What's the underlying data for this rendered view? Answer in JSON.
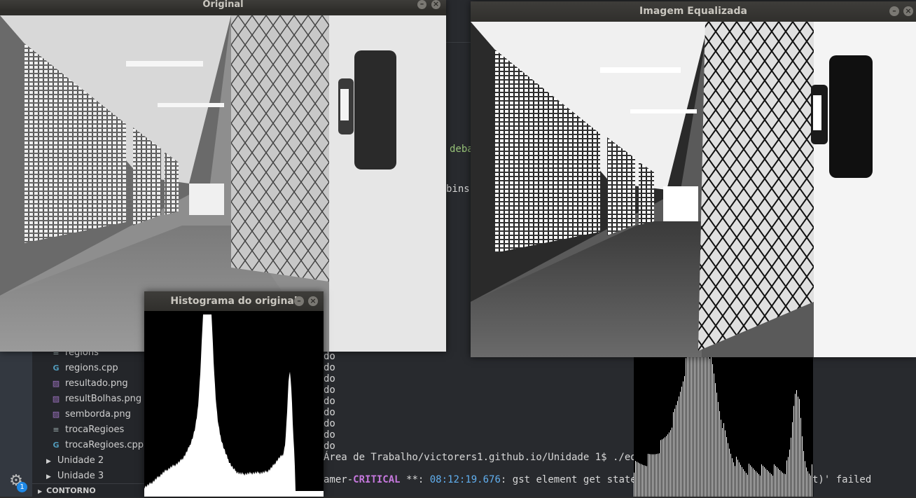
{
  "original_window": {
    "title": "Original"
  },
  "equalized_window": {
    "title": "Imagem Equalizada"
  },
  "histogram_window": {
    "title": "Histograma do original"
  },
  "sidebar": {
    "files": [
      {
        "name": "regions",
        "icon": "text-file-icon"
      },
      {
        "name": "regions.cpp",
        "icon": "cpp-file-icon"
      },
      {
        "name": "resultado.png",
        "icon": "image-file-icon"
      },
      {
        "name": "resultBolhas.png",
        "icon": "image-file-icon"
      },
      {
        "name": "semborda.png",
        "icon": "image-file-icon"
      },
      {
        "name": "trocaRegioes",
        "icon": "text-file-icon"
      },
      {
        "name": "trocaRegioes.cpp",
        "icon": "cpp-file-icon"
      }
    ],
    "folders": [
      "Unidade 2",
      "Unidade 3"
    ],
    "section": "CONTORNO",
    "settings_badge": "1"
  },
  "editor_fragments": {
    "frag1": "deba",
    "frag2": "bins)"
  },
  "terminal": {
    "do_lines": [
      "do",
      "do",
      "do",
      "do",
      "do",
      "do",
      "do",
      "do",
      "do",
      "do"
    ],
    "prompt_line": "Área de Trabalho/victorers1.github.io/Unidade 1$ ./equa",
    "error_prefix": "amer-",
    "error_level": "CRITICAL",
    "error_sep": " **: ",
    "error_time": "08:12:19.676",
    "error_msg": ": gst element get state: a",
    "error_tail": "t)' failed"
  },
  "colors": {
    "critical": "#c678dd",
    "timestamp": "#61afef",
    "badge": "#1e88e5"
  }
}
